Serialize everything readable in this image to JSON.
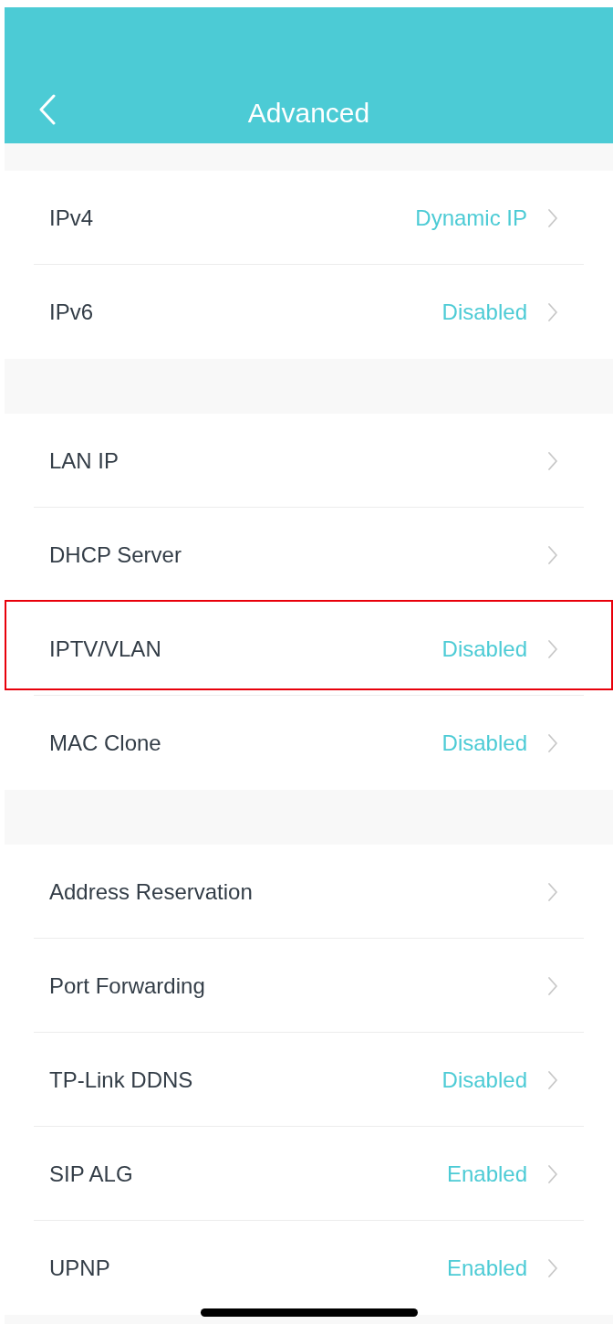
{
  "header": {
    "title": "Advanced"
  },
  "groups": [
    {
      "rows": [
        {
          "label": "IPv4",
          "value": "Dynamic IP",
          "highlighted": false
        },
        {
          "label": "IPv6",
          "value": "Disabled",
          "highlighted": false
        }
      ]
    },
    {
      "rows": [
        {
          "label": "LAN IP",
          "highlighted": false
        },
        {
          "label": "DHCP Server",
          "highlighted": false
        },
        {
          "label": "IPTV/VLAN",
          "value": "Disabled",
          "highlighted": true
        },
        {
          "label": "MAC Clone",
          "value": "Disabled",
          "highlighted": false
        }
      ]
    },
    {
      "rows": [
        {
          "label": "Address Reservation",
          "highlighted": false
        },
        {
          "label": "Port Forwarding",
          "highlighted": false
        },
        {
          "label": "TP-Link DDNS",
          "value": "Disabled",
          "highlighted": false
        },
        {
          "label": "SIP ALG",
          "value": "Enabled",
          "highlighted": false
        },
        {
          "label": "UPNP",
          "value": "Enabled",
          "highlighted": false
        }
      ]
    }
  ]
}
